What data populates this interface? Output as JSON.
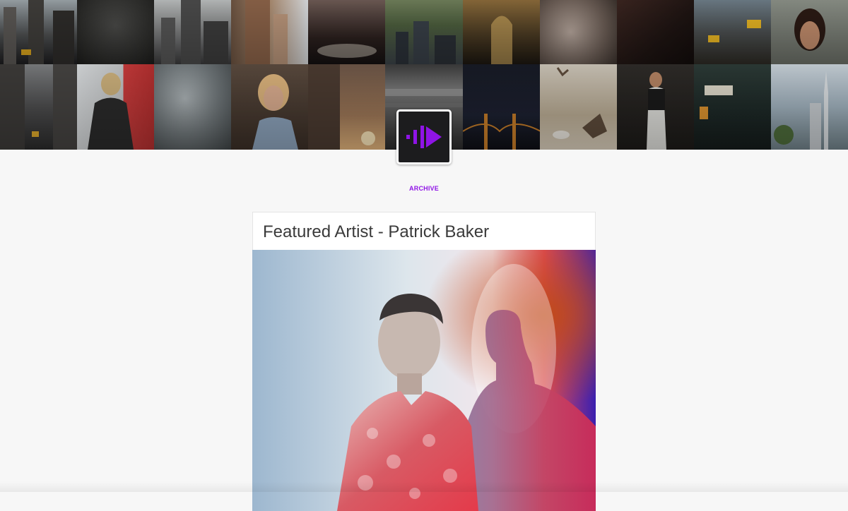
{
  "header": {
    "banner_tiles": [
      "city-street-photo",
      "dark-shirt-photo",
      "skyline-photo",
      "building-photo",
      "skirt-photo",
      "city-hills-photo",
      "arched-building-photo",
      "glitter-texture-photo",
      "dark-portrait-photo",
      "taxi-street-photo",
      "woman-portrait-photo",
      "avenue-photo",
      "tattooed-woman-photo",
      "ocean-wave-photo",
      "blonde-woman-photo",
      "sunset-building-photo",
      "bridge-underside-photo",
      "golden-gate-night-photo",
      "pigeons-photo",
      "woman-in-window-photo",
      "chinatown-street-photo",
      "san-francisco-photo"
    ],
    "logo_icon": "play-soundwave-icon",
    "brand_color": "#8f14e6"
  },
  "nav": {
    "archive_label": "ARCHIVE"
  },
  "post": {
    "title": "Featured Artist - Patrick Baker",
    "image": "artist-portrait-photo"
  }
}
